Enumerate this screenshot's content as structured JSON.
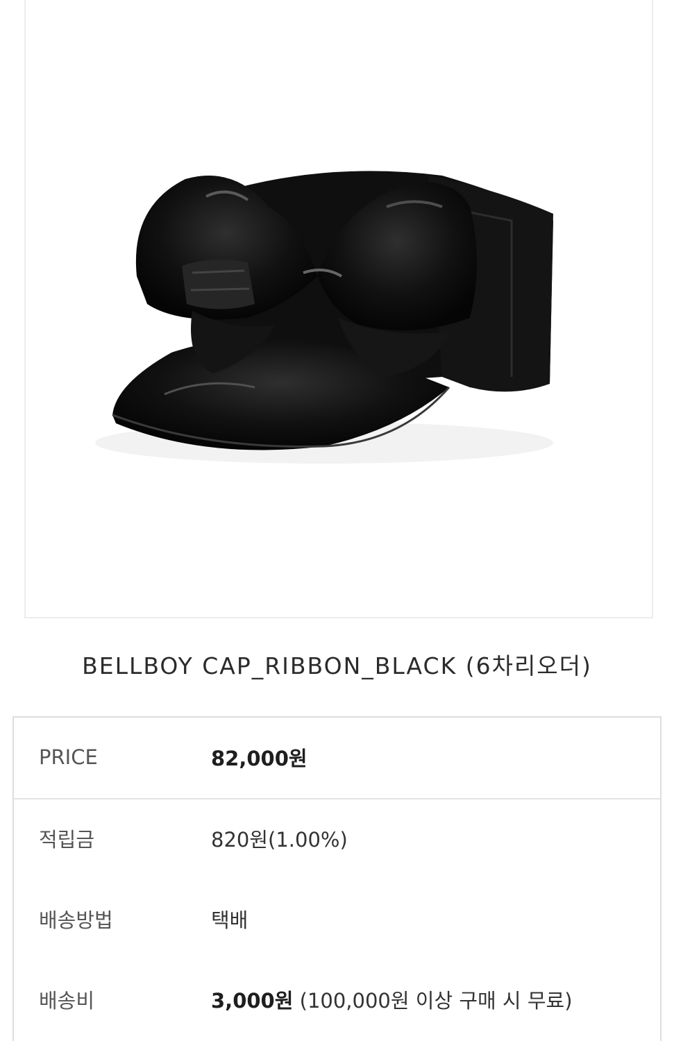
{
  "product": {
    "title": "BELLBOY CAP_RIBBON_BLACK (6차리오더)",
    "image_alt": "hat-image"
  },
  "info": {
    "price": {
      "label": "PRICE",
      "value": "82,000원"
    },
    "points": {
      "label": "적립금",
      "value": "820원(1.00%)"
    },
    "shipping_method": {
      "label": "배송방법",
      "value": "택배"
    },
    "shipping_fee": {
      "label": "배송비",
      "value": "3,000원",
      "note": "(100,000원 이상 구매 시 무료)"
    }
  },
  "colors": {
    "frame_border": "#ececec",
    "table_border": "#dedede",
    "product_black": "#0c0c0c"
  }
}
